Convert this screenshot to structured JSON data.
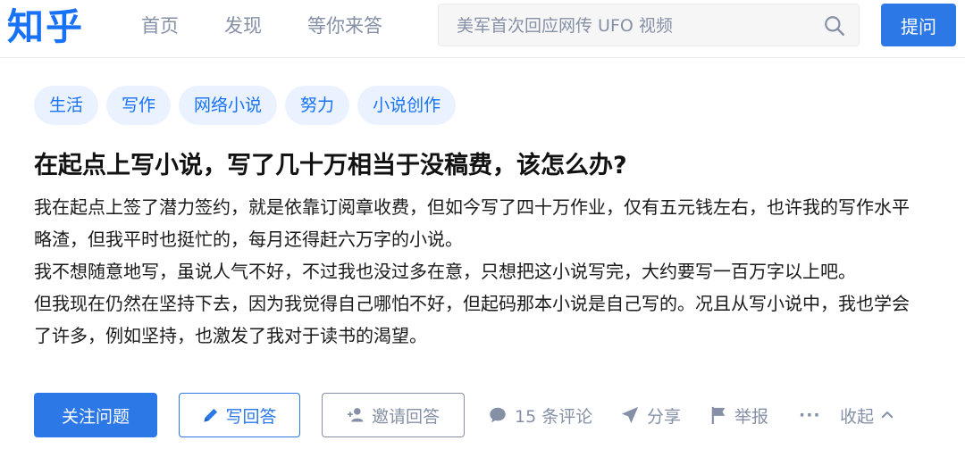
{
  "header": {
    "logo": "知乎",
    "nav": [
      "首页",
      "发现",
      "等你来答"
    ],
    "search_placeholder": "美军首次回应网传 UFO 视频",
    "ask_label": "提问"
  },
  "question": {
    "topics": [
      "生活",
      "写作",
      "网络小说",
      "努力",
      "小说创作"
    ],
    "title": "在起点上写小说，写了几十万相当于没稿费，该怎么办?",
    "detail_lines": [
      "我在起点上签了潜力签约，就是依靠订阅章收费，但如今写了四十万作业，仅有五元钱左右，也许我的写作水平略渣，但我平时也挺忙的，每月还得赶六万字的小说。",
      "我不想随意地写，虽说人气不好，不过我也没过多在意，只想把这小说写完，大约要写一百万字以上吧。",
      "但我现在仍然在坚持下去，因为我觉得自己哪怕不好，但起码那本小说是自己写的。况且从写小说中，我也学会了许多，例如坚持，也激发了我对于读书的渴望。"
    ]
  },
  "actions": {
    "follow_label": "关注问题",
    "write_label": "写回答",
    "invite_label": "邀请回答",
    "comments_label": "15 条评论",
    "share_label": "分享",
    "report_label": "举报",
    "more_label": "···",
    "collapse_label": "收起"
  },
  "colors": {
    "brand": "#1772f6",
    "button_blue": "#2b78e6",
    "muted": "#8590a6",
    "topic_bg": "#eaf2ff"
  },
  "icons": [
    "search-icon",
    "pencil-icon",
    "add-user-icon",
    "comment-icon",
    "share-icon",
    "flag-icon",
    "chevron-up-icon"
  ]
}
